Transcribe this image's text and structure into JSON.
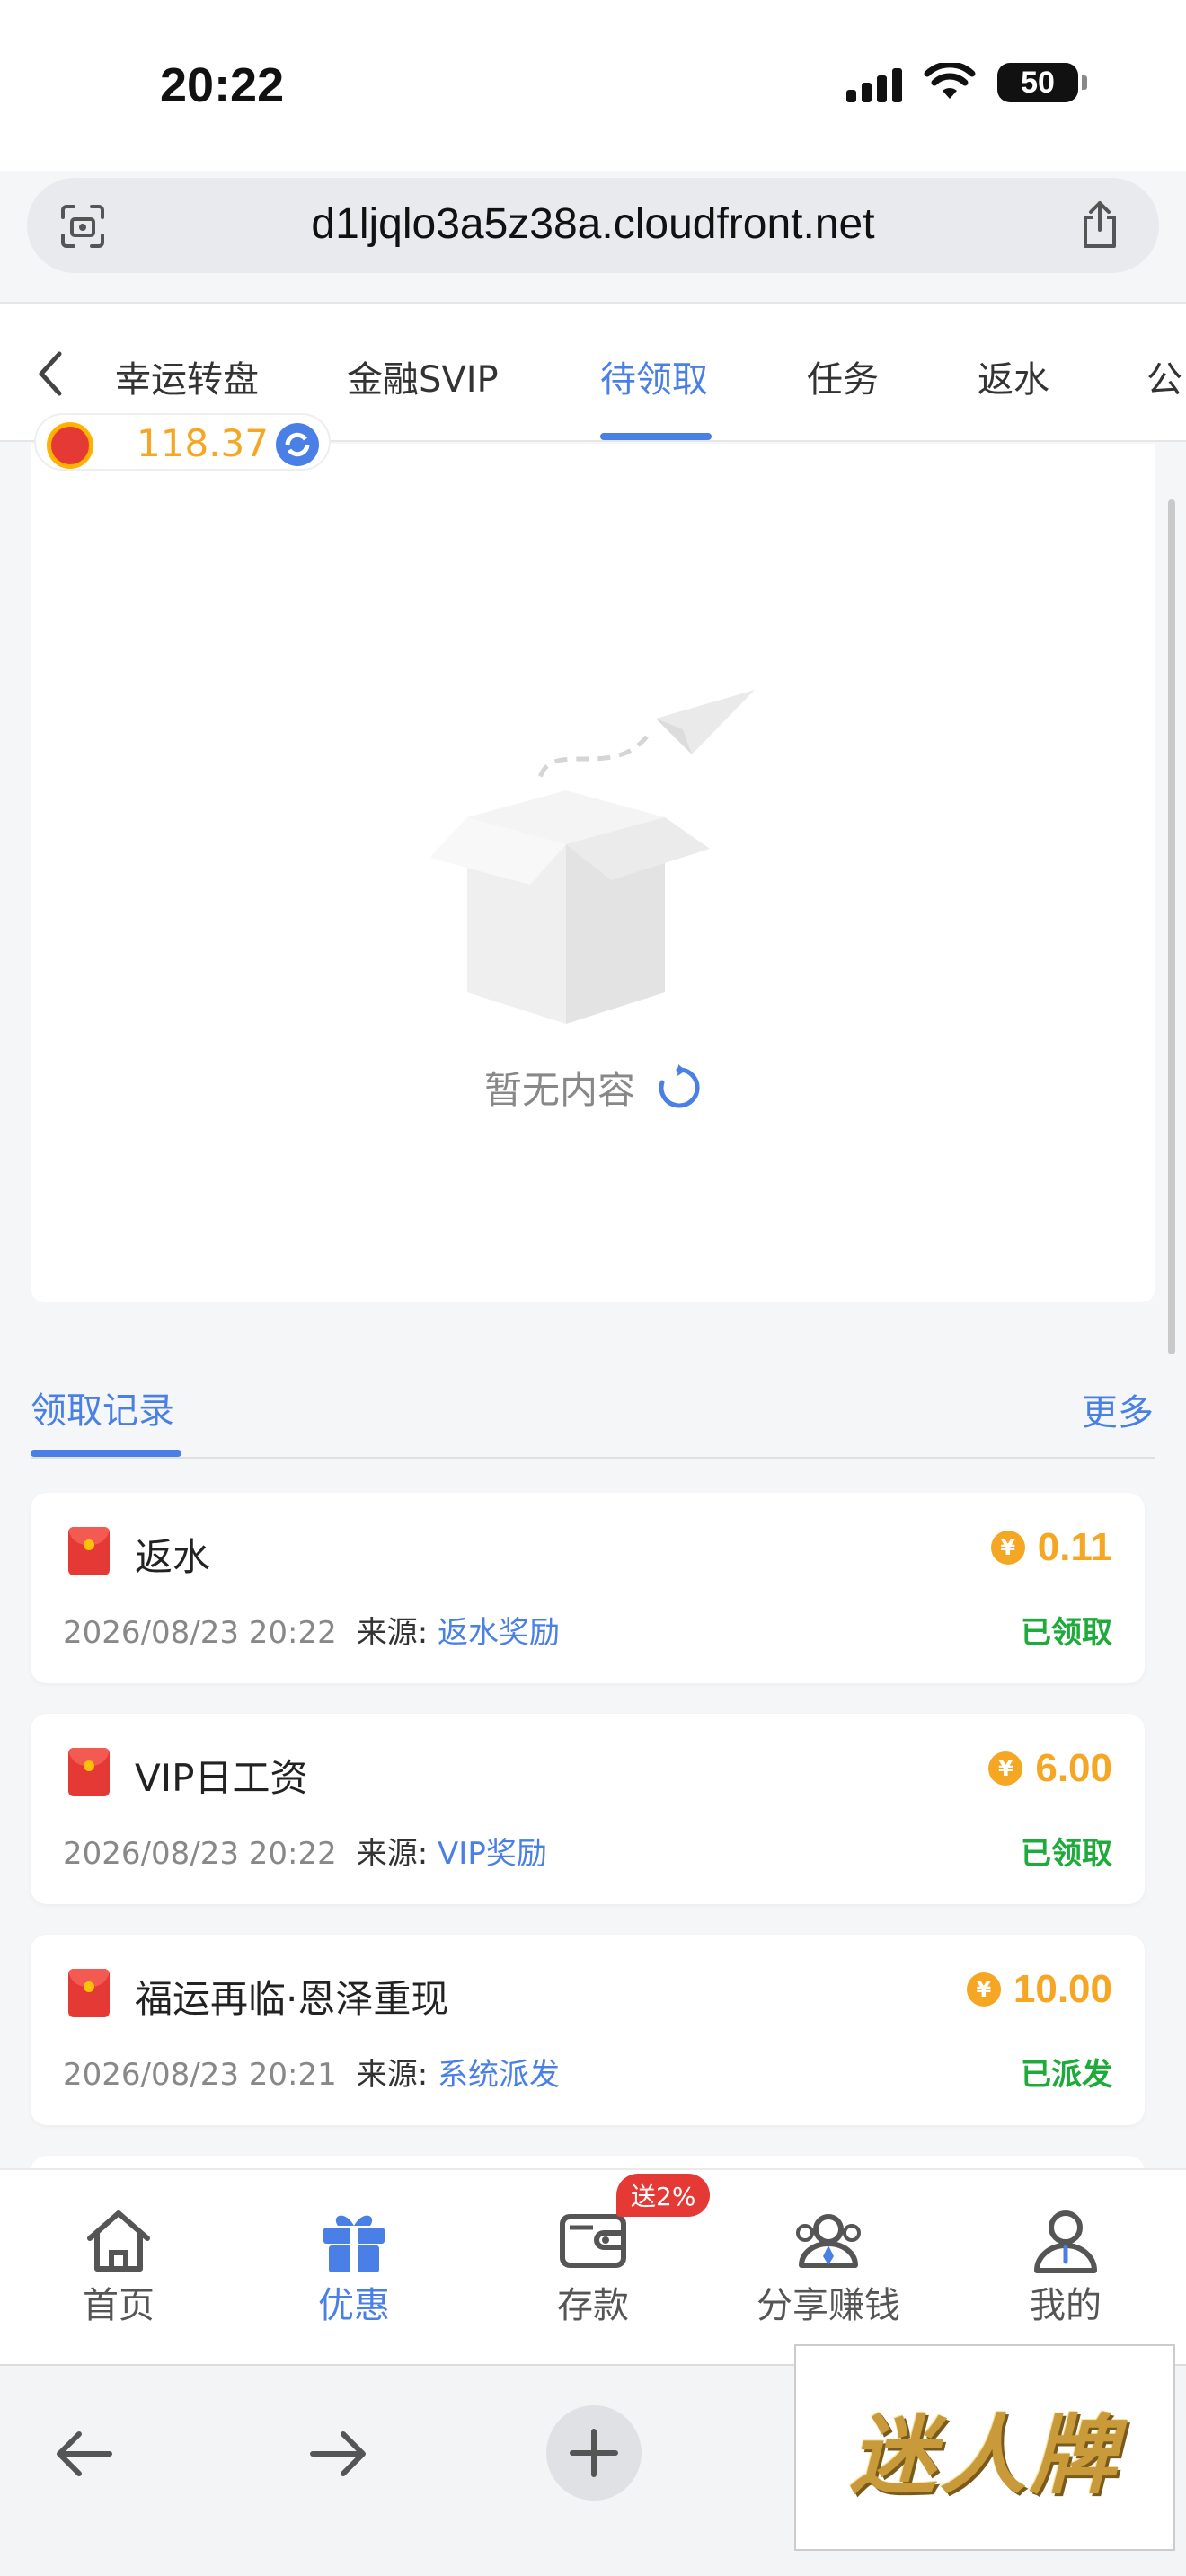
{
  "status_bar": {
    "time": "20:22",
    "battery": "50",
    "icons": [
      "signal-icon",
      "wifi-icon",
      "battery-icon"
    ]
  },
  "browser": {
    "url": "d1ljqlo3a5z38a.cloudfront.net",
    "icons": [
      "page-scan-icon",
      "share-icon"
    ]
  },
  "tabs": {
    "items": [
      {
        "label": "幸运转盘"
      },
      {
        "label": "金融SVIP"
      },
      {
        "label": "待领取"
      },
      {
        "label": "任务"
      },
      {
        "label": "返水"
      },
      {
        "label": "公"
      }
    ],
    "active_index": 2
  },
  "balance": {
    "value": "118.37"
  },
  "empty_state": {
    "text": "暂无内容"
  },
  "records": {
    "title": "领取记录",
    "more": "更多",
    "source_label": "来源:",
    "items": [
      {
        "title": "返水",
        "amount": "0.11",
        "time": "2026/08/23 20:22",
        "source": "返水奖励",
        "status": "已领取"
      },
      {
        "title": "VIP日工资",
        "amount": "6.00",
        "time": "2026/08/23 20:22",
        "source": "VIP奖励",
        "status": "已领取"
      },
      {
        "title": "福运再临·恩泽重现",
        "amount": "10.00",
        "time": "2026/08/23 20:21",
        "source": "系统派发",
        "status": "已派发"
      }
    ]
  },
  "bottom_nav": {
    "items": [
      {
        "label": "首页",
        "icon": "home-icon"
      },
      {
        "label": "优惠",
        "icon": "gift-icon"
      },
      {
        "label": "存款",
        "icon": "wallet-icon"
      },
      {
        "label": "分享赚钱",
        "icon": "share-earn-icon"
      },
      {
        "label": "我的",
        "icon": "user-icon"
      }
    ],
    "active_index": 1,
    "deposit_badge": "送2%"
  },
  "ad": {
    "text": "迷人牌"
  },
  "colors": {
    "accent": "#4a80e6",
    "amount": "#f5a623",
    "success": "#1eab3c",
    "badge": "#e53935"
  }
}
